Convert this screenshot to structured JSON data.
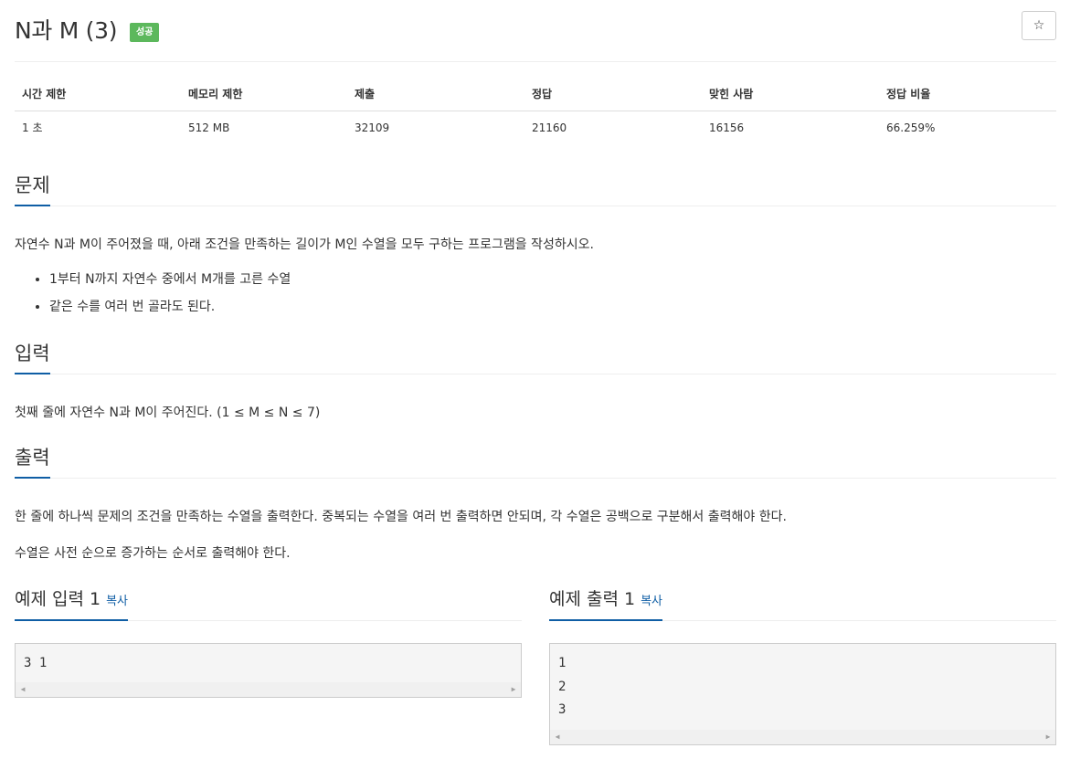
{
  "header": {
    "title": "N과 M (3)",
    "badge": "성공",
    "star_icon": "☆"
  },
  "info_table": {
    "columns": [
      "시간 제한",
      "메모리 제한",
      "제출",
      "정답",
      "맞힌 사람",
      "정답 비율"
    ],
    "values": [
      "1 초",
      "512 MB",
      "32109",
      "21160",
      "16156",
      "66.259%"
    ]
  },
  "problem": {
    "heading": "문제",
    "text": "자연수 N과 M이 주어졌을 때, 아래 조건을 만족하는 길이가 M인 수열을 모두 구하는 프로그램을 작성하시오.",
    "bullets": [
      "1부터 N까지 자연수 중에서 M개를 고른 수열",
      "같은 수를 여러 번 골라도 된다."
    ]
  },
  "input": {
    "heading": "입력",
    "text": "첫째 줄에 자연수 N과 M이 주어진다. (1 ≤ M ≤ N ≤ 7)"
  },
  "output": {
    "heading": "출력",
    "text1": "한 줄에 하나씩 문제의 조건을 만족하는 수열을 출력한다. 중복되는 수열을 여러 번 출력하면 안되며, 각 수열은 공백으로 구분해서 출력해야 한다.",
    "text2": "수열은 사전 순으로 증가하는 순서로 출력해야 한다."
  },
  "sample_input": {
    "heading": "예제 입력 1",
    "copy_label": "복사",
    "lines": [
      "3 1"
    ]
  },
  "sample_output": {
    "heading": "예제 출력 1",
    "copy_label": "복사",
    "lines": [
      "1",
      "2",
      "3"
    ]
  },
  "colors": {
    "accent": "#0f5ea5",
    "success": "#5cb85c"
  }
}
